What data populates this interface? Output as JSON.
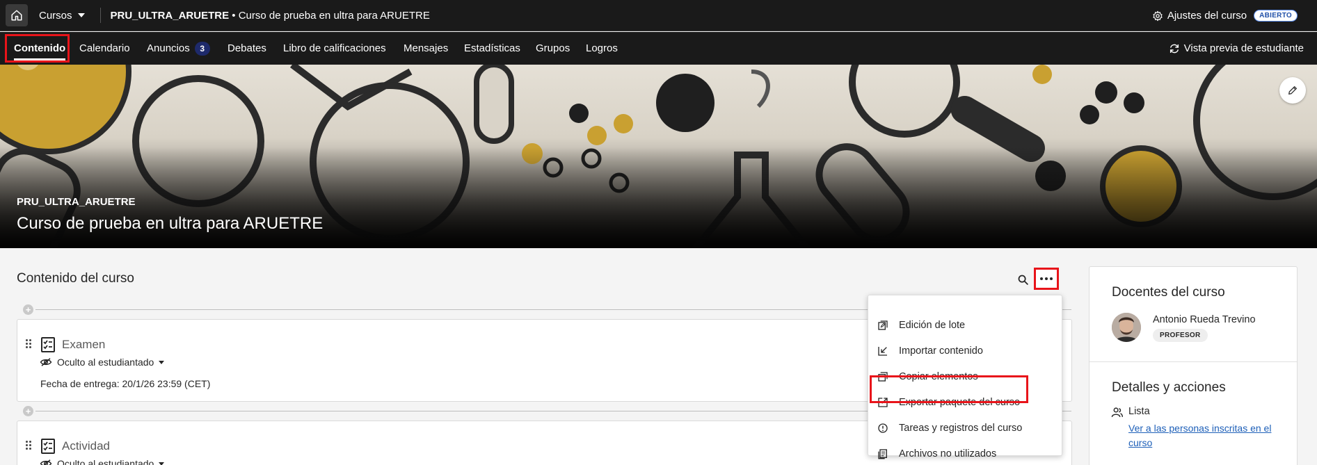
{
  "topbar": {
    "cursos_label": "Cursos",
    "course_code": "PRU_ULTRA_ARUETRE",
    "course_separator": " • ",
    "course_name": "Curso de prueba en ultra para ARUETRE",
    "settings_label": "Ajustes del curso",
    "status_badge": "ABIERTO"
  },
  "nav": {
    "items": [
      {
        "label": "Contenido"
      },
      {
        "label": "Calendario"
      },
      {
        "label": "Anuncios",
        "badge": "3"
      },
      {
        "label": "Debates"
      },
      {
        "label": "Libro de calificaciones"
      },
      {
        "label": "Mensajes"
      },
      {
        "label": "Estadísticas"
      },
      {
        "label": "Grupos"
      },
      {
        "label": "Logros"
      }
    ],
    "preview_label": "Vista previa de estudiante"
  },
  "banner": {
    "code": "PRU_ULTRA_ARUETRE",
    "title": "Curso de prueba en ultra para ARUETRE"
  },
  "content": {
    "title": "Contenido del curso",
    "items": [
      {
        "title": "Examen",
        "visibility": "Oculto al estudiantado",
        "due": "Fecha de entrega: 20/1/26 23:59 (CET)"
      },
      {
        "title": "Actividad",
        "visibility": "Oculto al estudiantado"
      }
    ]
  },
  "menu": {
    "items": [
      {
        "label": "Edición de lote",
        "icon": "batch-edit-icon"
      },
      {
        "label": "Importar contenido",
        "icon": "import-icon"
      },
      {
        "label": "Copiar elementos",
        "icon": "copy-icon"
      },
      {
        "label": "Exportar paquete del curso",
        "icon": "export-icon"
      },
      {
        "label": "Tareas y registros del curso",
        "icon": "info-icon"
      },
      {
        "label": "Archivos no utilizados",
        "icon": "files-icon"
      }
    ]
  },
  "side": {
    "teachers_title": "Docentes del curso",
    "teacher_name": "Antonio Rueda Trevino",
    "teacher_role": "PROFESOR",
    "details_title": "Detalles y acciones",
    "roster_label": "Lista",
    "roster_link": "Ver a las personas inscritas en el curso"
  },
  "colors": {
    "highlight": "#e8141a",
    "topbar": "#1a1a1a",
    "link": "#1d5fb8",
    "nav_badge": "#1e2a6b"
  }
}
